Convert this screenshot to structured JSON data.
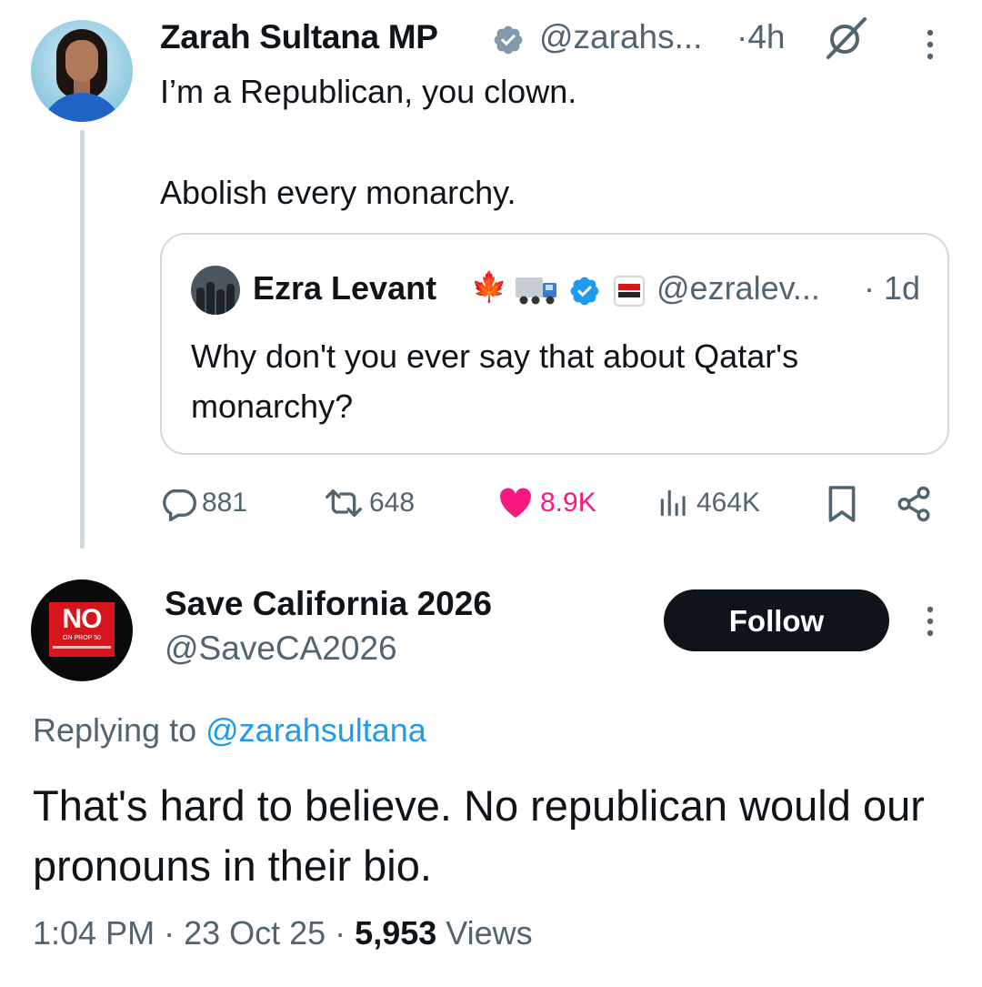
{
  "parent_tweet": {
    "author_name": "Zarah Sultana MP",
    "handle": "@zarahs...",
    "separator": "·",
    "time": "4h",
    "text_line1": "I’m a Republican, you clown.",
    "text_line2": "Abolish every monarchy.",
    "quote": {
      "author_name": "Ezra Levant",
      "emoji_maple": "🍁",
      "handle": "@ezralev...",
      "time": "· 1d",
      "text": "Why don't you ever say that about Qatar's monarchy?"
    },
    "actions": {
      "replies": "881",
      "reposts": "648",
      "likes": "8.9K",
      "views": "464K"
    }
  },
  "reply_tweet": {
    "author_name": "Save California 2026",
    "handle": "@SaveCA2026",
    "follow_label": "Follow",
    "avatar": {
      "text": "NO",
      "subtext": "ON PROP 50"
    },
    "replying_prefix": "Replying to",
    "replying_to": "@zarahsultana",
    "text": "That's hard to believe. No republican would our pronouns in their bio.",
    "time": "1:04 PM",
    "date": "23 Oct 25",
    "views_count": "5,953",
    "views_label": "Views"
  },
  "colors": {
    "text": "#0f1419",
    "secondary": "#536471",
    "link": "#1d9bf0",
    "like": "#f91880",
    "verified": "#1d9bf0",
    "border": "#cfd9de",
    "button_bg": "#0f1419"
  },
  "icons": [
    "verified-badge-icon",
    "grok-icon",
    "more-icon",
    "reply-icon",
    "repost-icon",
    "like-icon",
    "views-icon",
    "bookmark-icon",
    "share-icon",
    "truck-icon",
    "rebel-news-icon"
  ]
}
